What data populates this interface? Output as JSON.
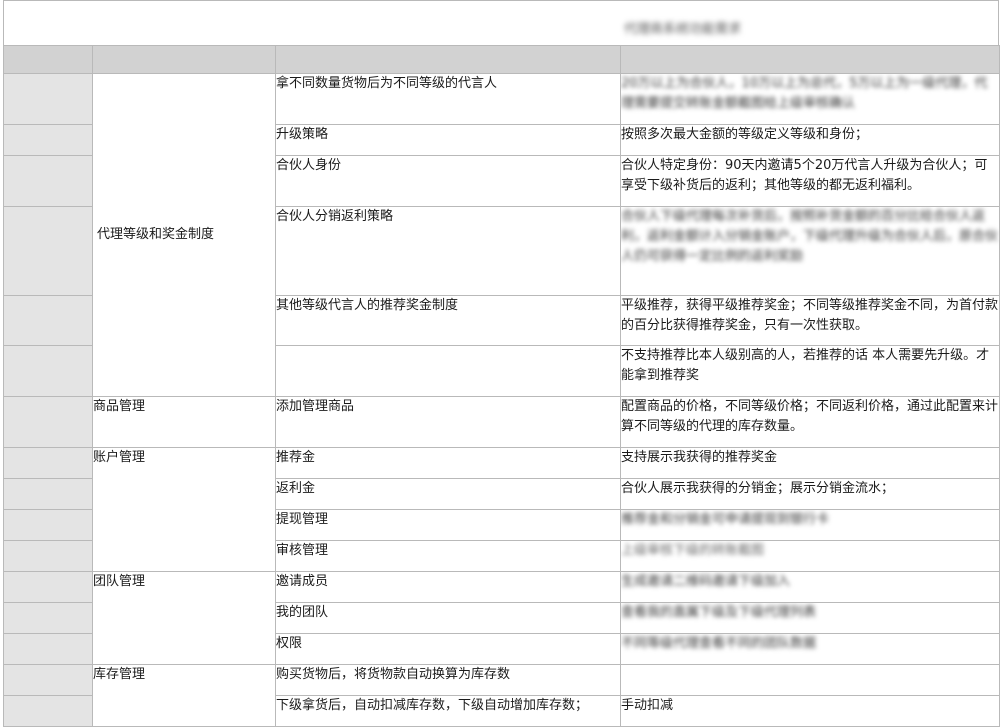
{
  "title": "代理商系统功能需求",
  "categories": {
    "level": "代理等级和奖金制度",
    "product": "商品管理",
    "account": "账户管理",
    "team": "团队管理",
    "inventory": "库存管理"
  },
  "rows": [
    {
      "feature": "拿不同数量货物后为不同等级的代言人",
      "desc": "20万以上为合伙人，10万以上为总代，5万以上为一级代理，代理需要提交转账金额截图给上级审核确认"
    },
    {
      "feature": "升级策略",
      "desc": "按照多次最大金额的等级定义等级和身份；"
    },
    {
      "feature": "合伙人身份",
      "desc": "合伙人特定身份：90天内邀请5个20万代言人升级为合伙人；可享受下级补货后的返利；其他等级的都无返利福利。"
    },
    {
      "feature": "合伙人分销返利策略",
      "desc": "合伙人下级代理每次补货后，按照补货金额的百分比给合伙人返利，返利金额计入分销金账户，下级代理升级为合伙人后，原合伙人仍可获得一定比例的返利奖励"
    },
    {
      "feature": "其他等级代言人的推荐奖金制度",
      "desc": "平级推荐，获得平级推荐奖金；不同等级推荐奖金不同，为首付款的百分比获得推荐奖金，只有一次性获取。"
    },
    {
      "feature": "",
      "desc": "不支持推荐比本人级别高的人，若推荐的话 本人需要先升级。才能拿到推荐奖"
    },
    {
      "feature": "添加管理商品",
      "desc": "配置商品的价格，不同等级价格；不同返利价格，通过此配置来计算不同等级的代理的库存数量。"
    },
    {
      "feature": "推荐金",
      "desc": "支持展示我获得的推荐奖金"
    },
    {
      "feature": "返利金",
      "desc": "合伙人展示我获得的分销金；展示分销金流水；"
    },
    {
      "feature": "提现管理",
      "desc": "推荐金和分销金可申请提现到银行卡"
    },
    {
      "feature": "审核管理",
      "desc": "上级审核下级的转账截图"
    },
    {
      "feature": "邀请成员",
      "desc": "生成邀请二维码邀请下级加入"
    },
    {
      "feature": "我的团队",
      "desc": "查看我的直属下级及下级代理列表"
    },
    {
      "feature": "权限",
      "desc": "不同等级代理查看不同的团队数据"
    },
    {
      "feature": "购买货物后，将货物款自动换算为库存数",
      "desc": ""
    },
    {
      "feature": "下级拿货后，自动扣减库存数，下级自动增加库存数；",
      "desc": "手动扣减"
    }
  ]
}
